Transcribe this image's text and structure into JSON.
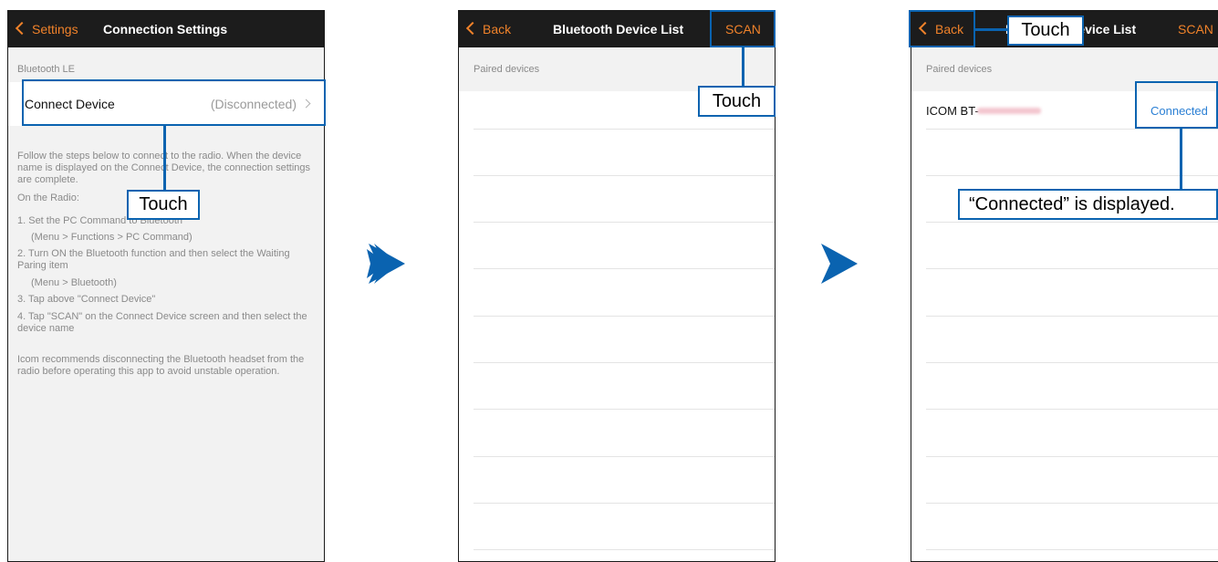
{
  "screen1": {
    "back_label": "Settings",
    "title": "Connection Settings",
    "section_header": "Bluetooth LE",
    "connect_label": "Connect Device",
    "connect_status": "(Disconnected)",
    "instructions": [
      "Follow the steps below to connect to the radio. When the device name is displayed on the Connect Device, the connection settings are complete.",
      "On the Radio:",
      "1. Set the PC Command to Bluetooth",
      "(Menu > Functions > PC Command)",
      "2. Turn ON the Bluetooth function and then select the Waiting Paring item",
      "(Menu > Bluetooth)",
      "3. Tap above \"Connect Device\"",
      "4. Tap \"SCAN\" on the Connect Device screen and then select the device name",
      "Icom recommends disconnecting the Bluetooth headset from the radio before operating this app to avoid unstable operation."
    ],
    "callout_label": "Touch"
  },
  "screen2": {
    "back_label": "Back",
    "title": "Bluetooth Device List",
    "scan_label": "SCAN",
    "section_header": "Paired devices",
    "callout_label": "Touch"
  },
  "screen3": {
    "back_label": "Back",
    "title": "Bluetooth Device List",
    "scan_label": "SCAN",
    "section_header": "Paired devices",
    "device_name": "ICOM BT-",
    "device_status": "Connected",
    "callout_back_label": "Touch",
    "callout_connected_label": "“Connected” is displayed."
  },
  "colors": {
    "accent": "#f0822a",
    "callout": "#0a63b0",
    "nav_bg": "#1c1c1c",
    "connected_text": "#2a7fd4"
  }
}
